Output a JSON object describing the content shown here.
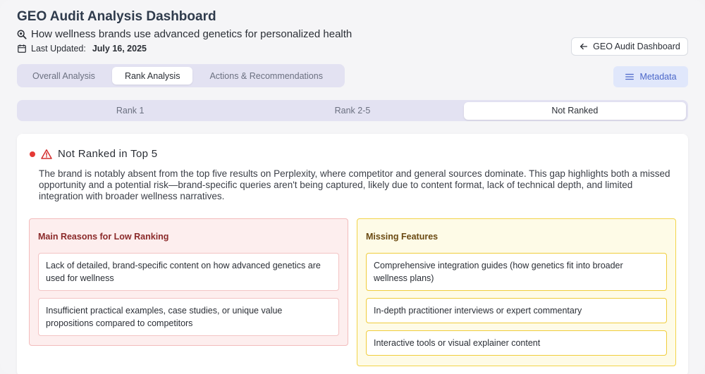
{
  "header": {
    "title": "GEO Audit Analysis Dashboard",
    "query": "How wellness brands use advanced genetics for personalized health",
    "updated_label": "Last Updated:",
    "updated_date": "July 16, 2025",
    "query_icon": "search-icon",
    "calendar_icon": "calendar-icon"
  },
  "actions": {
    "back_label": "GEO Audit Dashboard",
    "metadata_label": "Metadata"
  },
  "tabs": [
    {
      "label": "Overall Analysis",
      "active": false
    },
    {
      "label": "Rank Analysis",
      "active": true
    },
    {
      "label": "Actions & Recommendations",
      "active": false
    }
  ],
  "rank_tabs": [
    {
      "label": "Rank 1",
      "active": false
    },
    {
      "label": "Rank 2-5",
      "active": false
    },
    {
      "label": "Not Ranked",
      "active": true
    }
  ],
  "card": {
    "title": "Not Ranked in Top 5",
    "description": "The brand is notably absent from the top five results on Perplexity, where competitor and general sources dominate. This gap highlights both a missed opportunity and a potential risk—brand-specific queries aren't being captured, likely due to content format, lack of technical depth, and limited integration with broader wellness narratives.",
    "status_color": "#e53935"
  },
  "reasons": {
    "title": "Main Reasons for Low Ranking",
    "items": [
      "Lack of detailed, brand-specific content on how advanced genetics are used for wellness",
      "Insufficient practical examples, case studies, or unique value propositions compared to competitors"
    ]
  },
  "missing": {
    "title": "Missing Features",
    "items": [
      "Comprehensive integration guides (how genetics fit into broader wellness plans)",
      "In-depth practitioner interviews or expert commentary",
      "Interactive tools or visual explainer content"
    ]
  }
}
